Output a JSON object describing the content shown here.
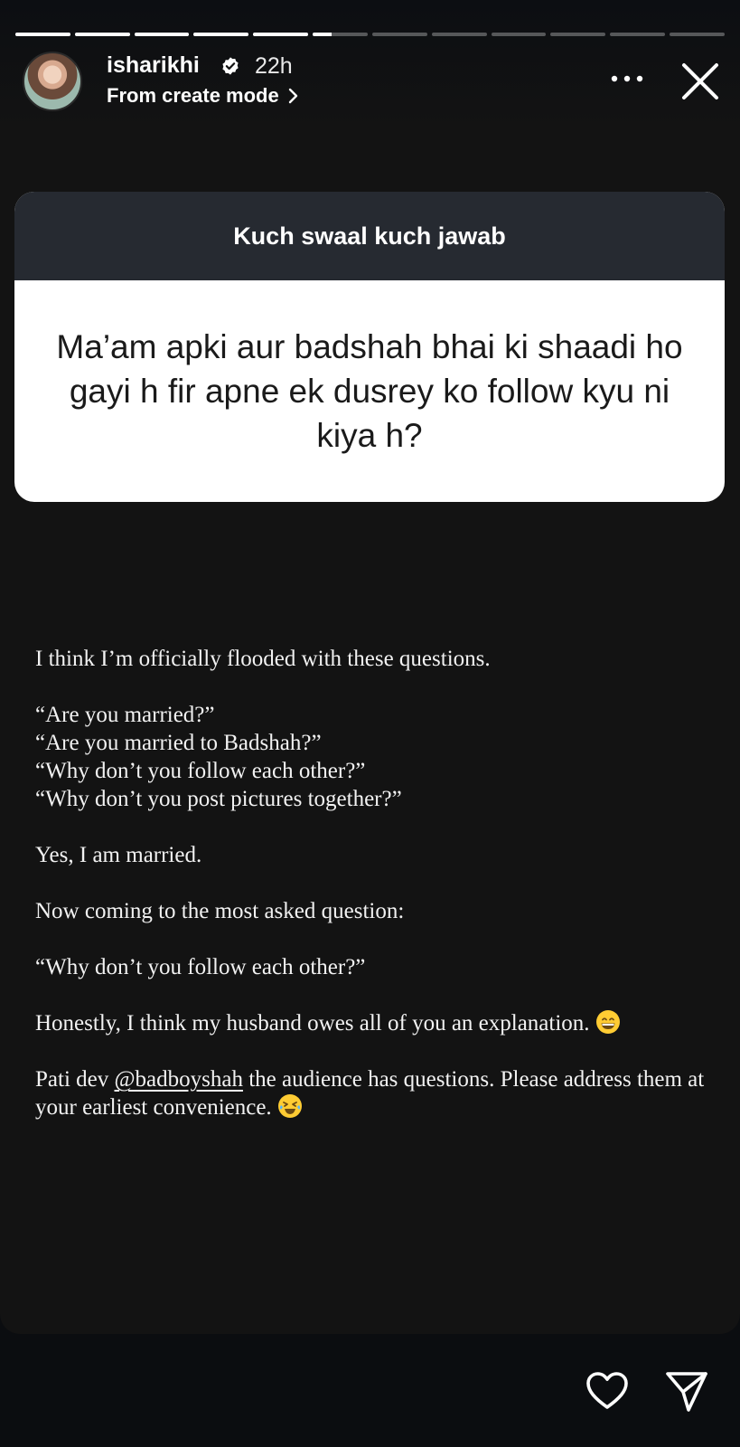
{
  "progress": {
    "segment_count": 12,
    "completed_segments": 5,
    "current_segment_fill": 0.35
  },
  "header": {
    "username": "isharikhi",
    "verified_icon": "verified-badge-icon",
    "time": "22h",
    "subline": "From create mode",
    "subline_icon": "chevron-right-icon",
    "more_icon": "more-options-icon",
    "close_icon": "close-icon"
  },
  "question_card": {
    "title": "Kuch swaal kuch jawab",
    "question": "Ma’am apki aur badshah bhai ki shaadi ho gayi h fir apne ek dusrey ko follow kyu ni kiya h?"
  },
  "answer": {
    "line1": "I think I’m officially flooded with these questions.",
    "q1": "“Are you married?”",
    "q2": "“Are you married to Badshah?”",
    "q3": "“Why don’t you follow each other?”",
    "q4": "“Why don’t you post pictures together?”",
    "line2": "Yes, I am married.",
    "line3": "Now coming to the most asked question:",
    "line4": "“Why don’t you follow each other?”",
    "line5": "Honestly, I think my husband owes all of you an explanation.",
    "line5_emoji": "grinning-face-emoji",
    "line6_prefix": "Pati dev ",
    "mention": "@badboyshah",
    "line6_suffix": " the audience has questions. Please address them at your earliest convenience.",
    "line6_emoji": "rolling-laughing-emoji"
  },
  "footer": {
    "like_icon": "heart-icon",
    "share_icon": "send-icon"
  },
  "colors": {
    "background": "#131313",
    "card_header": "#262a31",
    "card_body": "#ffffff",
    "text": "#f2f2f2"
  }
}
